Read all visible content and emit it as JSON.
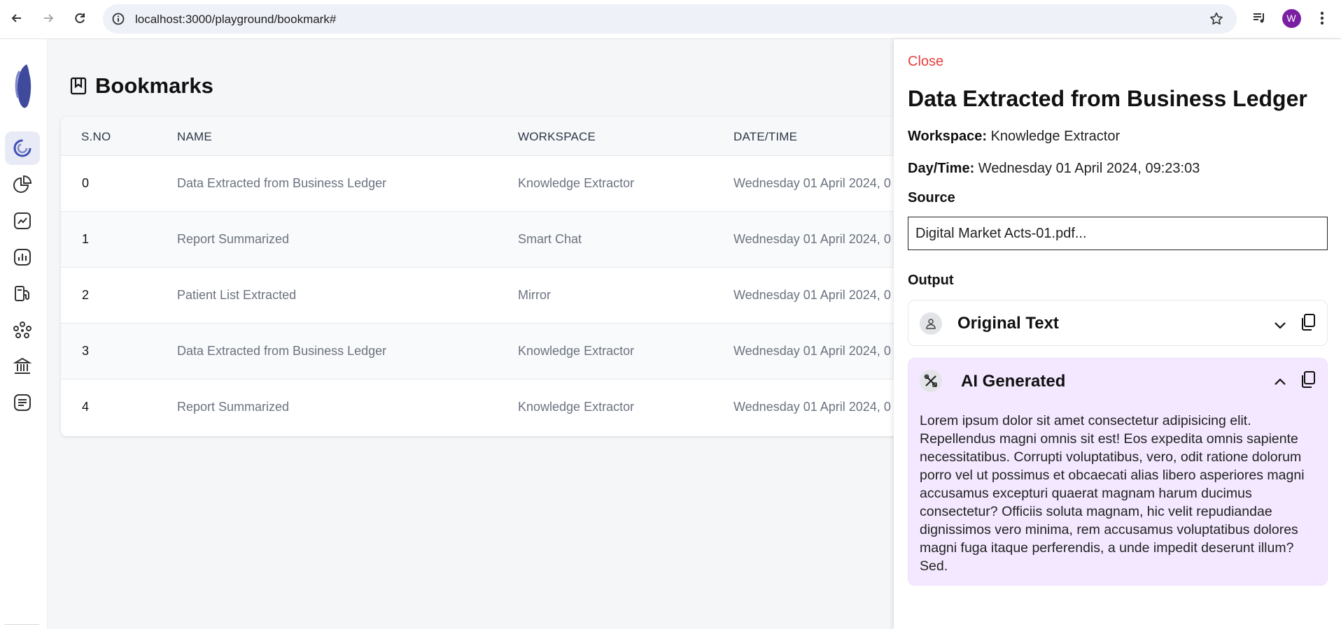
{
  "browser": {
    "url": "localhost:3000/playground/bookmark#",
    "profile_initial": "W"
  },
  "sidebar": {
    "items": [
      {
        "icon": "dashboard-ring-icon",
        "active": true
      },
      {
        "icon": "pie-chart-icon",
        "active": false
      },
      {
        "icon": "trend-chart-icon",
        "active": false
      },
      {
        "icon": "bar-chart-icon",
        "active": false
      },
      {
        "icon": "fuel-pump-icon",
        "active": false
      },
      {
        "icon": "network-icon",
        "active": false
      },
      {
        "icon": "bank-icon",
        "active": false
      },
      {
        "icon": "chat-list-icon",
        "active": false
      }
    ]
  },
  "page": {
    "title": "Bookmarks"
  },
  "table": {
    "headers": {
      "sno": "S.NO",
      "name": "NAME",
      "workspace": "WORKSPACE",
      "datetime": "DATE/TIME"
    },
    "rows": [
      {
        "sno": "0",
        "name": "Data Extracted from Business Ledger",
        "workspace": "Knowledge Extractor",
        "datetime": "Wednesday 01 April 2024, 0"
      },
      {
        "sno": "1",
        "name": "Report Summarized",
        "workspace": "Smart Chat",
        "datetime": "Wednesday 01 April 2024, 0"
      },
      {
        "sno": "2",
        "name": "Patient List Extracted",
        "workspace": "Mirror",
        "datetime": "Wednesday 01 April 2024, 0"
      },
      {
        "sno": "3",
        "name": "Data Extracted from Business Ledger",
        "workspace": "Knowledge Extractor",
        "datetime": "Wednesday 01 April 2024, 0"
      },
      {
        "sno": "4",
        "name": "Report Summarized",
        "workspace": "Knowledge Extractor",
        "datetime": "Wednesday 01 April 2024, 0"
      }
    ]
  },
  "drawer": {
    "close_label": "Close",
    "title": "Data Extracted from Business Ledger",
    "workspace_label": "Workspace:",
    "workspace_value": "Knowledge Extractor",
    "daytime_label": "Day/Time:",
    "daytime_value": "Wednesday 01 April 2024, 09:23:03",
    "source_label": "Source",
    "source_value": "Digital Market Acts-01.pdf...",
    "output_label": "Output",
    "original_title": "Original Text",
    "ai_title": "AI Generated",
    "ai_text": "Lorem ipsum dolor sit amet consectetur adipisicing elit. Repellendus magni omnis sit est! Eos expedita omnis sapiente necessitatibus. Corrupti voluptatibus, vero, odit ratione dolorum porro vel ut possimus et obcaecati alias libero asperiores magni accusamus excepturi quaerat magnam harum ducimus consectetur? Officiis soluta magnam, hic velit repudiandae dignissimos vero minima, rem accusamus voluptatibus dolores magni fuga itaque perferendis, a unde impedit deserunt illum? Sed."
  },
  "colors": {
    "accent": "#5c6bc0",
    "close": "#e53e3e",
    "ai_panel": "#f3e8ff"
  }
}
